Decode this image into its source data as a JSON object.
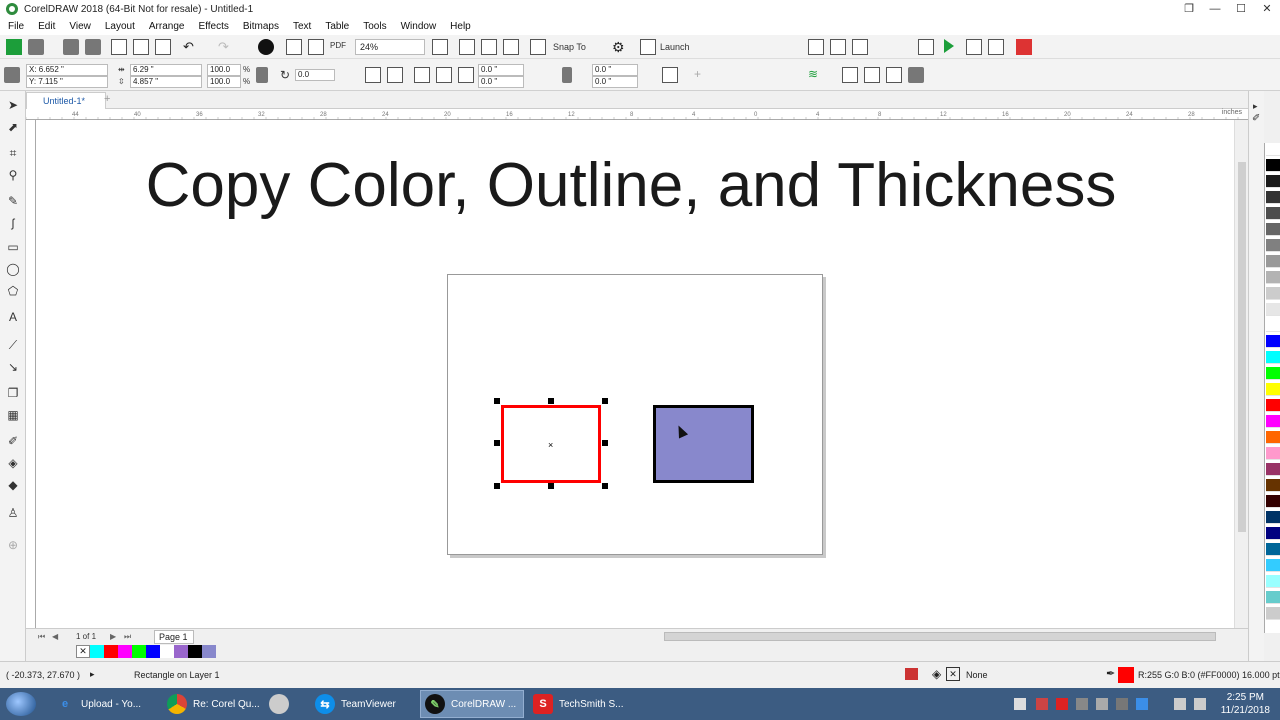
{
  "app": {
    "title": "CorelDRAW 2018 (64-Bit Not for resale) - Untitled-1",
    "window_buttons": [
      "restore-down",
      "minimize",
      "maximize",
      "close"
    ]
  },
  "menu": [
    "File",
    "Edit",
    "View",
    "Layout",
    "Arrange",
    "Effects",
    "Bitmaps",
    "Text",
    "Table",
    "Tools",
    "Window",
    "Help"
  ],
  "toolbar": {
    "zoom": "24%",
    "snap_to": "Snap To",
    "launch": "Launch",
    "pdf_label": "PDF"
  },
  "property_bar": {
    "x": "X: 6.652 \"",
    "y": "Y: 7.115 \"",
    "width": "6.29 \"",
    "height": "4.857 \"",
    "scale_w": "100.0",
    "scale_h": "100.0",
    "percent": "%",
    "rotation": "0.0",
    "corner_a1": "0.0 \"",
    "corner_a2": "0.0 \"",
    "corner_b1": "0.0 \"",
    "corner_b2": "0.0 \""
  },
  "doc_tab": "Untitled-1*",
  "ruler_unit": "inches",
  "ruler_h_labels": [
    "44",
    "40",
    "36",
    "32",
    "28",
    "24",
    "20",
    "16",
    "12",
    "8",
    "4",
    "0",
    "4",
    "8",
    "12",
    "16",
    "20",
    "24",
    "28"
  ],
  "canvas": {
    "headline": "Copy Color, Outline, and Thickness",
    "center_mark": "×"
  },
  "navigator": {
    "page_of": "1 of 1",
    "page_tab": "Page 1"
  },
  "status": {
    "coords": "( -20.373, 27.670 )",
    "selection": "Rectangle on Layer 1",
    "fill_none": "None",
    "outline_info": "R:255 G:0 B:0 (#FF0000)  16.000 pt"
  },
  "colors": {
    "selected_outline": "#ff0000",
    "blue_fill": "#8888cc",
    "blue_outline": "#000000"
  },
  "palette": [
    "#ffffff",
    "#000000",
    "#1a1a1a",
    "#333333",
    "#4d4d4d",
    "#666666",
    "#808080",
    "#999999",
    "#b3b3b3",
    "#cccccc",
    "#e6e6e6",
    "#ffffff",
    "#0000ff",
    "#00ffff",
    "#00ff00",
    "#ffff00",
    "#ff0000",
    "#ff00ff",
    "#ff6600",
    "#ff99cc",
    "#993366",
    "#663300",
    "#330000",
    "#003366",
    "#000080",
    "#006699",
    "#33ccff",
    "#99ffff",
    "#66cccc",
    "#cccccc"
  ],
  "doc_palette": [
    "none",
    "#00ffff",
    "#ff0000",
    "#ff00ff",
    "#00ff00",
    "#0000ff",
    "#ffffff",
    "#9966cc",
    "#000000",
    "#8888cc"
  ],
  "taskbar": {
    "tasks": [
      "Upload - Yo...",
      "Re: Corel Qu...",
      "",
      "TeamViewer",
      "CorelDRAW ...",
      "TechSmith S..."
    ],
    "time": "2:25 PM",
    "date": "11/21/2018"
  }
}
